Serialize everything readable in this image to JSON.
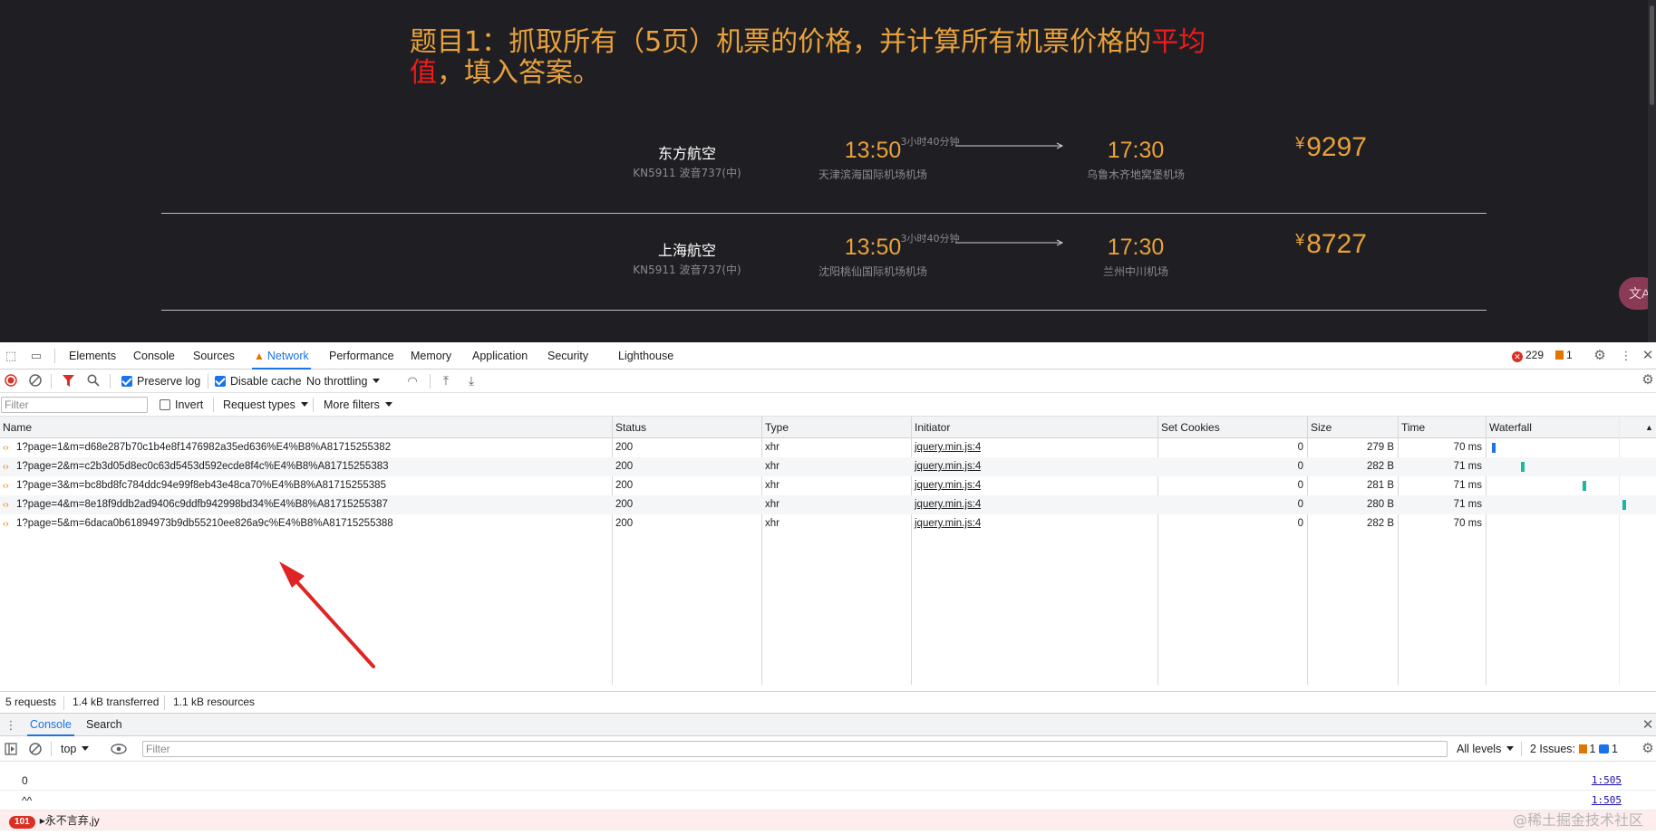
{
  "page": {
    "question_prefix": "题目1：抓取所有（5页）机票的价格，并计算所有机票价格的",
    "question_highlight_1": "平均",
    "question_highlight_2": "值",
    "question_suffix": "，填入答案。",
    "currency": "¥",
    "flights": [
      {
        "airline": "东方航空",
        "aircraft": "KN5911 波音737(中)",
        "dep_time": "13:50",
        "dep_airport": "天津滨海国际机场机场",
        "duration": "3小时40分钟",
        "arr_time": "17:30",
        "arr_airport": "乌鲁木齐地窝堡机场",
        "price": "9297"
      },
      {
        "airline": "上海航空",
        "aircraft": "KN5911 波音737(中)",
        "dep_time": "13:50",
        "dep_airport": "沈阳桃仙国际机场机场",
        "duration": "3小时40分钟",
        "arr_time": "17:30",
        "arr_airport": "兰州中川机场",
        "price": "8727"
      }
    ],
    "translate_label": "文A"
  },
  "devtools": {
    "tabs": [
      "Elements",
      "Console",
      "Sources",
      "Network",
      "Performance",
      "Memory",
      "Application",
      "Security",
      "Lighthouse"
    ],
    "active_tab": "Network",
    "errors_count": "229",
    "warnings_count": "1",
    "toolbar": {
      "preserve_log": "Preserve log",
      "disable_cache": "Disable cache",
      "throttling": "No throttling"
    },
    "filterbar": {
      "filter_placeholder": "Filter",
      "invert": "Invert",
      "request_types": "Request types",
      "more_filters": "More filters"
    },
    "columns": [
      "Name",
      "Status",
      "Type",
      "Initiator",
      "Set Cookies",
      "Size",
      "Time",
      "Waterfall"
    ],
    "requests": [
      {
        "name": "1?page=1&m=d68e287b70c1b4e8f1476982a35ed636%E4%B8%A81715255382",
        "status": "200",
        "type": "xhr",
        "initiator": "jquery.min.js:4",
        "cookies": "0",
        "size": "279 B",
        "time": "70 ms"
      },
      {
        "name": "1?page=2&m=c2b3d05d8ec0c63d5453d592ecde8f4c%E4%B8%A81715255383",
        "status": "200",
        "type": "xhr",
        "initiator": "jquery.min.js:4",
        "cookies": "0",
        "size": "282 B",
        "time": "71 ms"
      },
      {
        "name": "1?page=3&m=bc8bd8fc784ddc94e99f8eb43e48ca70%E4%B8%A81715255385",
        "status": "200",
        "type": "xhr",
        "initiator": "jquery.min.js:4",
        "cookies": "0",
        "size": "281 B",
        "time": "71 ms"
      },
      {
        "name": "1?page=4&m=8e18f9ddb2ad9406c9ddfb942998bd34%E4%B8%A81715255387",
        "status": "200",
        "type": "xhr",
        "initiator": "jquery.min.js:4",
        "cookies": "0",
        "size": "280 B",
        "time": "71 ms"
      },
      {
        "name": "1?page=5&m=6daca0b61894973b9db55210ee826a9c%E4%B8%A81715255388",
        "status": "200",
        "type": "xhr",
        "initiator": "jquery.min.js:4",
        "cookies": "0",
        "size": "282 B",
        "time": "70 ms"
      }
    ],
    "summary": {
      "requests": "5 requests",
      "transferred": "1.4 kB transferred",
      "resources": "1.1 kB resources"
    },
    "drawer": {
      "tabs": [
        "Console",
        "Search"
      ],
      "context": "top",
      "filter_placeholder": "Filter",
      "levels": "All levels",
      "issues_label": "2 Issues:",
      "issues_warn": "1",
      "issues_info": "1",
      "lines": [
        {
          "text": "0",
          "source": "1:505"
        },
        {
          "text": "^^",
          "source": "1:505"
        }
      ],
      "error_count": "101",
      "error_text": "▸永不言弃,jy"
    }
  },
  "watermark": "@稀土掘金技术社区"
}
